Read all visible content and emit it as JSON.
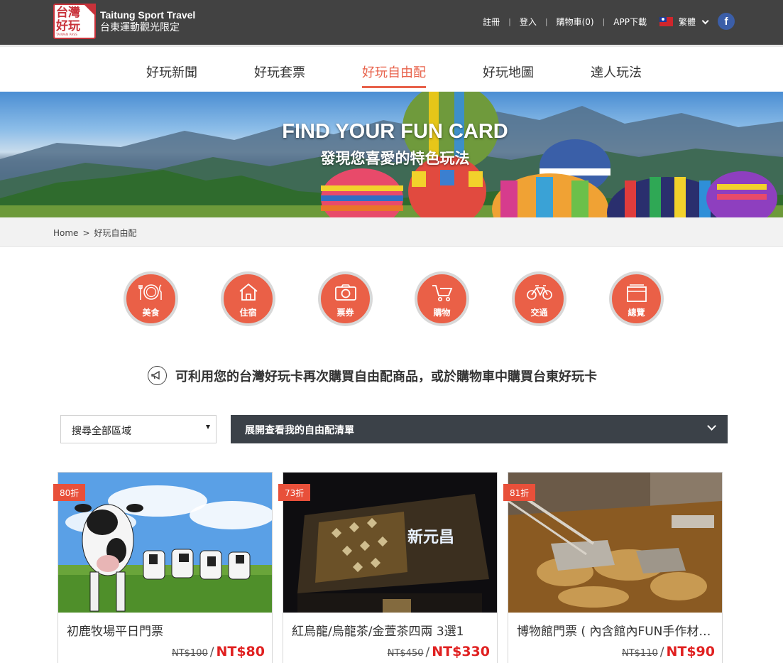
{
  "header": {
    "logo_zh_line1": "台灣",
    "logo_zh_line2": "好玩",
    "logo_pass": "TAIWAN PASS",
    "site_name_en": "Taitung Sport Travel",
    "site_name_zh": "台東運動觀光限定",
    "links": {
      "register": "註冊",
      "login": "登入",
      "cart": "購物車(0)",
      "app": "APP下載"
    },
    "language": "繁體"
  },
  "nav": {
    "items": [
      "好玩新聞",
      "好玩套票",
      "好玩自由配",
      "好玩地圖",
      "達人玩法"
    ],
    "active_index": 2
  },
  "banner": {
    "title": "FIND YOUR FUN CARD",
    "subtitle": "發現您喜愛的特色玩法"
  },
  "breadcrumb": {
    "home": "Home",
    "separator": ">",
    "current": "好玩自由配"
  },
  "categories": [
    {
      "label": "美食",
      "icon": "dining-icon"
    },
    {
      "label": "住宿",
      "icon": "house-icon"
    },
    {
      "label": "票券",
      "icon": "camera-icon"
    },
    {
      "label": "購物",
      "icon": "cart-icon"
    },
    {
      "label": "交通",
      "icon": "bicycle-icon"
    },
    {
      "label": "總覽",
      "icon": "overview-icon"
    }
  ],
  "notice": {
    "text": "可利用您的台灣好玩卡再次購買自由配商品，或於購物車中購買台東好玩卡",
    "icon": "megaphone-icon"
  },
  "filters": {
    "region_selected": "搜尋全部區域",
    "my_list_label": "展開查看我的自由配清單"
  },
  "products": [
    {
      "badge": "80折",
      "name": "初鹿牧場平日門票",
      "old_price": "NT$100",
      "slash": "/",
      "price": "NT$80"
    },
    {
      "badge": "73折",
      "name": "紅烏龍/烏龍茶/金萱茶四兩 3選1",
      "old_price": "NT$450",
      "slash": "/",
      "price": "NT$330"
    },
    {
      "badge": "81折",
      "name": "博物館門票 ( 內含館內FUN手作材料費 )",
      "old_price": "NT$110",
      "slash": "/",
      "price": "NT$90"
    }
  ],
  "product_images": [
    {
      "sign_text": "新元昌"
    }
  ],
  "colors": {
    "accent": "#e8624b",
    "topbar": "#424242",
    "price": "#e02020",
    "dark_button": "#3b4148"
  }
}
